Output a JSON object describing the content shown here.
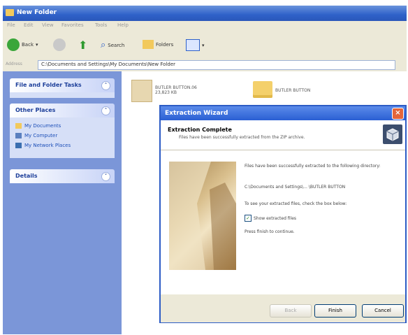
{
  "window": {
    "title": "New Folder"
  },
  "menubar": [
    "File",
    "Edit",
    "View",
    "Favorites",
    "Tools",
    "Help"
  ],
  "toolbar": {
    "back": "Back",
    "search": "Search",
    "folders": "Folders"
  },
  "address": {
    "label": "Address",
    "path": "C:\\Documents and Settings\\My Documents\\New Folder"
  },
  "leftpane": {
    "file_tasks": "File and Folder Tasks",
    "other_places": "Other Places",
    "places": [
      "My Documents",
      "My Computer",
      "My Network Places"
    ],
    "details": "Details"
  },
  "files": [
    {
      "name": "BUTLER BUTTON.06",
      "sub": "23,823 KB"
    },
    {
      "name": "BUTLER BUTTON",
      "sub": ""
    }
  ],
  "dialog": {
    "title": "Extraction Wizard",
    "heading": "Extraction Complete",
    "subheading": "Files have been successfully extracted from the ZIP archive.",
    "msg1": "Files have been successfully extracted to the following directory:",
    "path": "C:\\Documents and Settings\\... \\BUTLER BUTTON",
    "msg2": "To see your extracted files, check the box below:",
    "checkbox_label": "Show extracted files",
    "checkbox_checked": true,
    "msg3": "Press finish to continue.",
    "buttons": {
      "back": "Back",
      "finish": "Finish",
      "cancel": "Cancel"
    }
  },
  "colors": {
    "titlebar": "#2f61c9",
    "leftpane": "#7b96d8",
    "dialog_border": "#2c5cc5"
  }
}
